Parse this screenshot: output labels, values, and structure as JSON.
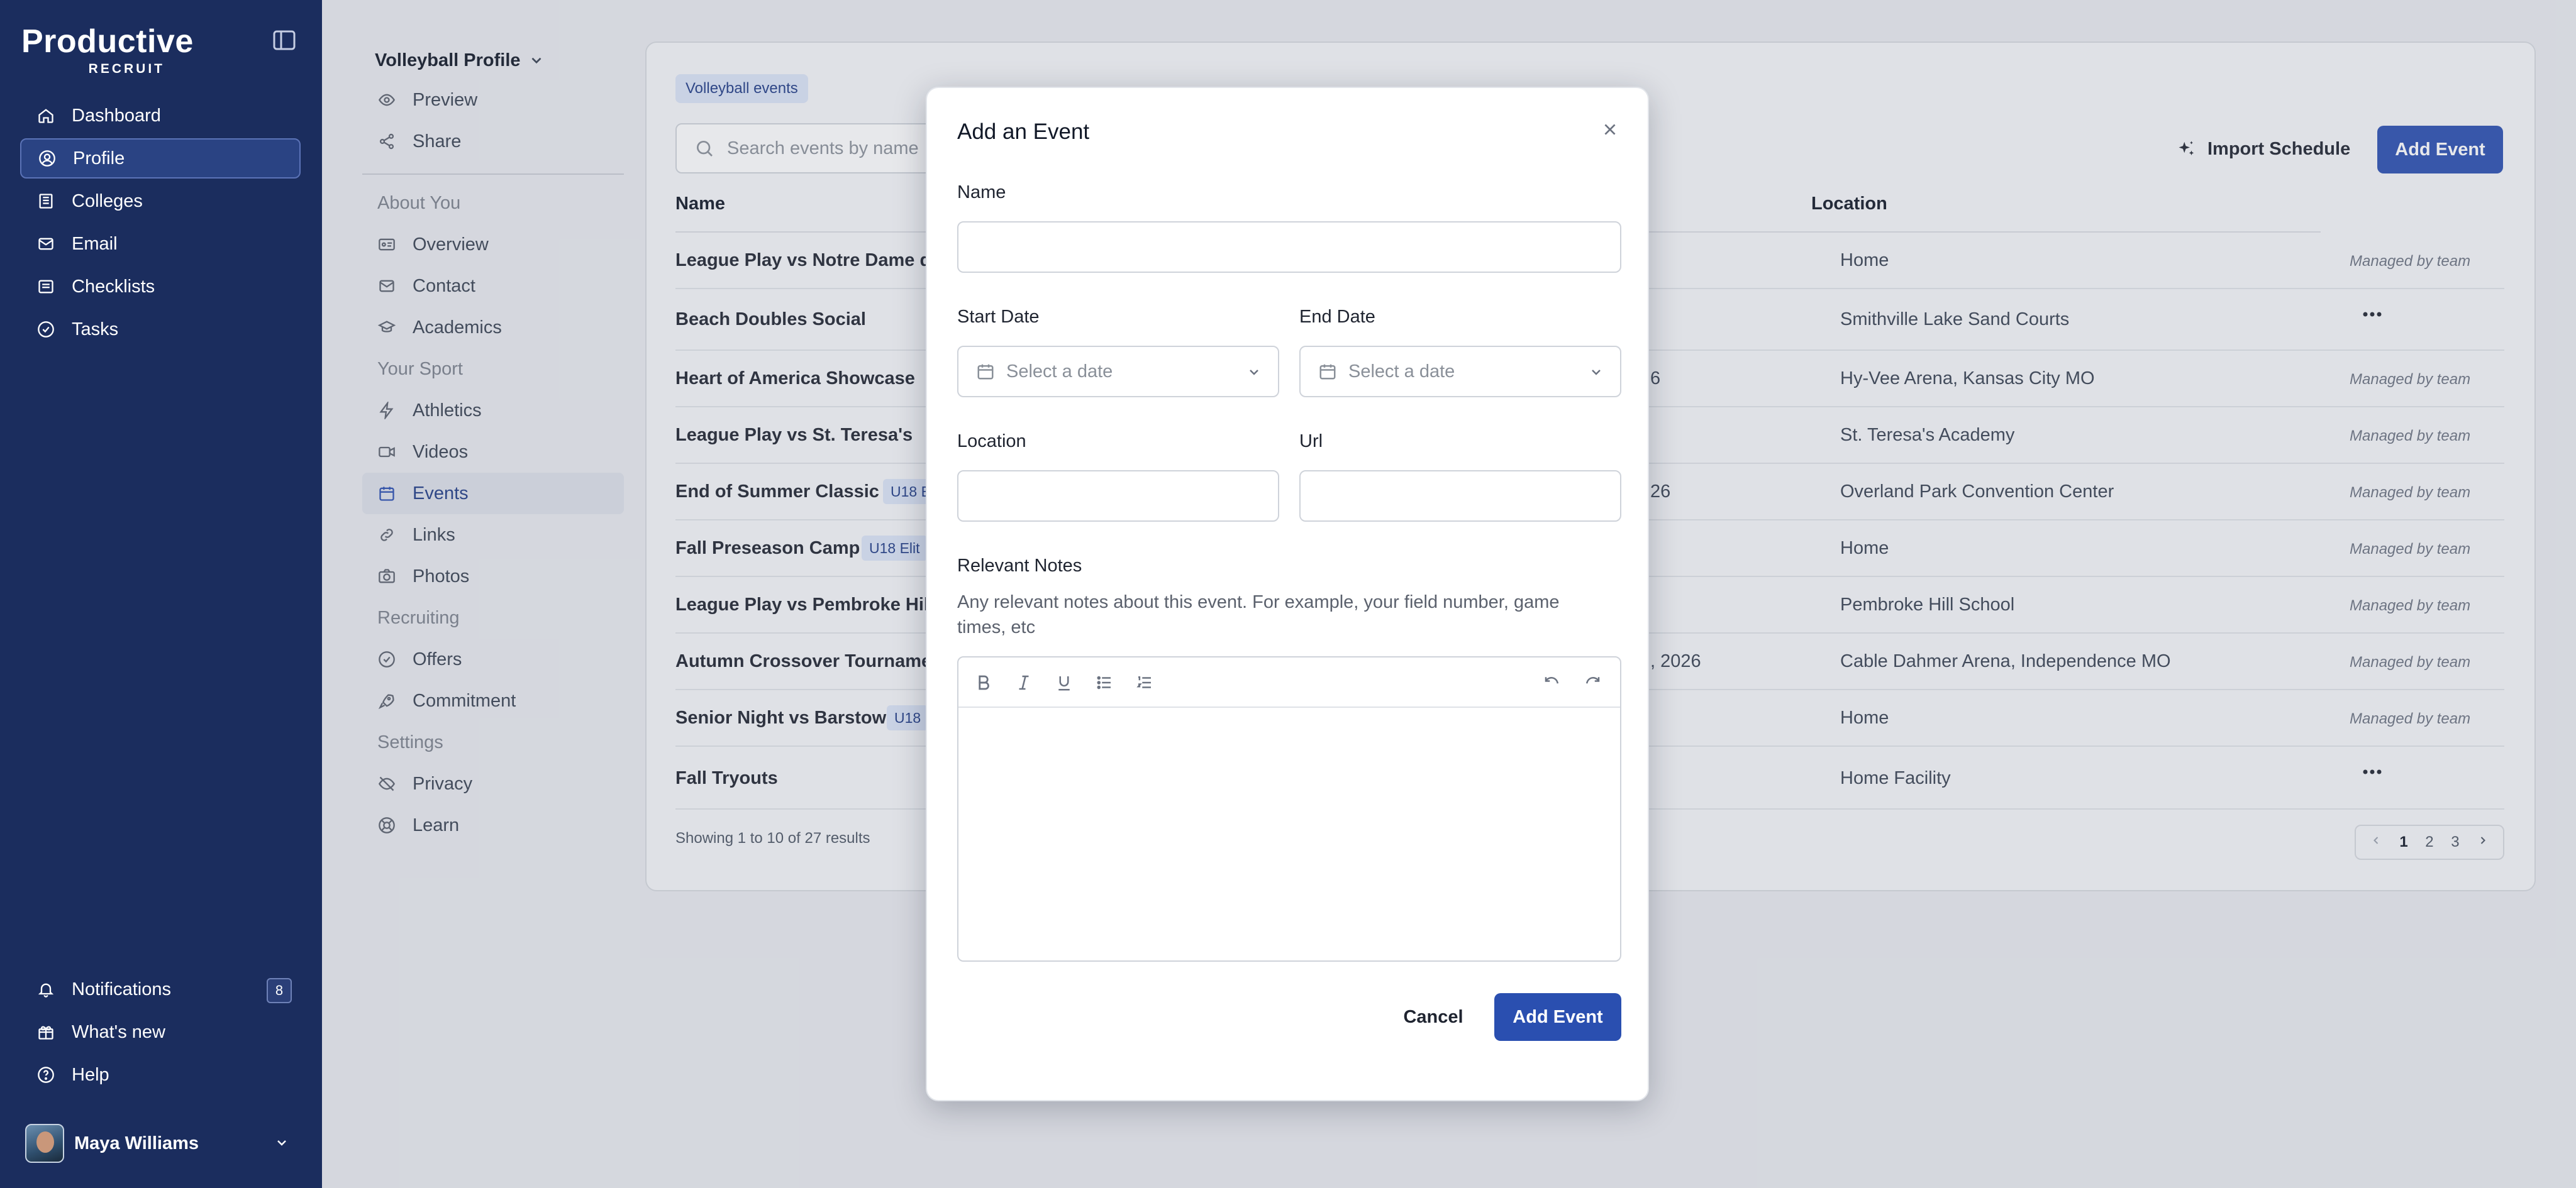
{
  "brand": {
    "name": "Productive",
    "sub": "RECRUIT"
  },
  "nav": {
    "items": [
      {
        "label": "Dashboard",
        "icon": "home-icon"
      },
      {
        "label": "Profile",
        "icon": "user-icon"
      },
      {
        "label": "Colleges",
        "icon": "college-icon"
      },
      {
        "label": "Email",
        "icon": "mail-icon"
      },
      {
        "label": "Checklists",
        "icon": "list-icon"
      },
      {
        "label": "Tasks",
        "icon": "check-circle-icon"
      }
    ],
    "bottom": [
      {
        "label": "Notifications",
        "icon": "bell-icon",
        "count": "8"
      },
      {
        "label": "What's new",
        "icon": "gift-icon"
      },
      {
        "label": "Help",
        "icon": "help-icon"
      }
    ],
    "user": "Maya Williams"
  },
  "subnav": {
    "title": "Volleyball Profile",
    "top": [
      "Preview",
      "Share"
    ],
    "groups": [
      {
        "label": "About You",
        "items": [
          "Overview",
          "Contact",
          "Academics"
        ]
      },
      {
        "label": "Your Sport",
        "items": [
          "Athletics",
          "Videos",
          "Events",
          "Links",
          "Photos"
        ]
      },
      {
        "label": "Recruiting",
        "items": [
          "Offers",
          "Commitment"
        ]
      },
      {
        "label": "Settings",
        "items": [
          "Privacy",
          "Learn"
        ]
      }
    ]
  },
  "events": {
    "chip": "Volleyball events",
    "search_placeholder": "Search events by name",
    "import_label": "Import Schedule",
    "add_label": "Add Event",
    "columns": {
      "name": "Name",
      "location": "Location"
    },
    "rows": [
      {
        "name": "League Play vs Notre Dame de",
        "tag": "",
        "date": "",
        "location": "Home",
        "status": "Managed by team"
      },
      {
        "name": "Beach Doubles Social",
        "tag": "",
        "date": "",
        "location": "Smithville Lake Sand Courts",
        "status": ""
      },
      {
        "name": "Heart of America Showcase",
        "tag": "",
        "date": "6",
        "location": "Hy-Vee Arena, Kansas City MO",
        "status": "Managed by team"
      },
      {
        "name": "League Play vs St. Teresa's",
        "tag": "",
        "date": "",
        "location": "St. Teresa's Academy",
        "status": "Managed by team"
      },
      {
        "name": "End of Summer Classic",
        "tag": "U18 E",
        "date": "26",
        "location": "Overland Park Convention Center",
        "status": "Managed by team"
      },
      {
        "name": "Fall Preseason Camp",
        "tag": "U18 Elit",
        "date": "",
        "location": "Home",
        "status": "Managed by team"
      },
      {
        "name": "League Play vs Pembroke Hill",
        "tag": "",
        "date": "",
        "location": "Pembroke Hill School",
        "status": "Managed by team"
      },
      {
        "name": "Autumn Crossover Tournamen",
        "tag": "",
        "date": ", 2026",
        "location": "Cable Dahmer Arena, Independence MO",
        "status": "Managed by team"
      },
      {
        "name": "Senior Night vs Barstow",
        "tag": "U18",
        "date": "",
        "location": "Home",
        "status": "Managed by team"
      },
      {
        "name": "Fall Tryouts",
        "tag": "",
        "date": "",
        "location": "Home Facility",
        "status": ""
      }
    ],
    "showing": "Showing 1 to 10 of 27 results",
    "pages": [
      "1",
      "2",
      "3"
    ]
  },
  "modal": {
    "title": "Add an Event",
    "name_label": "Name",
    "start_label": "Start Date",
    "end_label": "End Date",
    "date_placeholder": "Select a date",
    "location_label": "Location",
    "url_label": "Url",
    "notes_label": "Relevant Notes",
    "notes_help": "Any relevant notes about this event. For example, your field number, game times, etc",
    "cancel_label": "Cancel",
    "submit_label": "Add Event"
  },
  "colors": {
    "sidebar": "#1b2d5e",
    "accent": "#2a4fb0",
    "chip": "#dbe4f7"
  }
}
